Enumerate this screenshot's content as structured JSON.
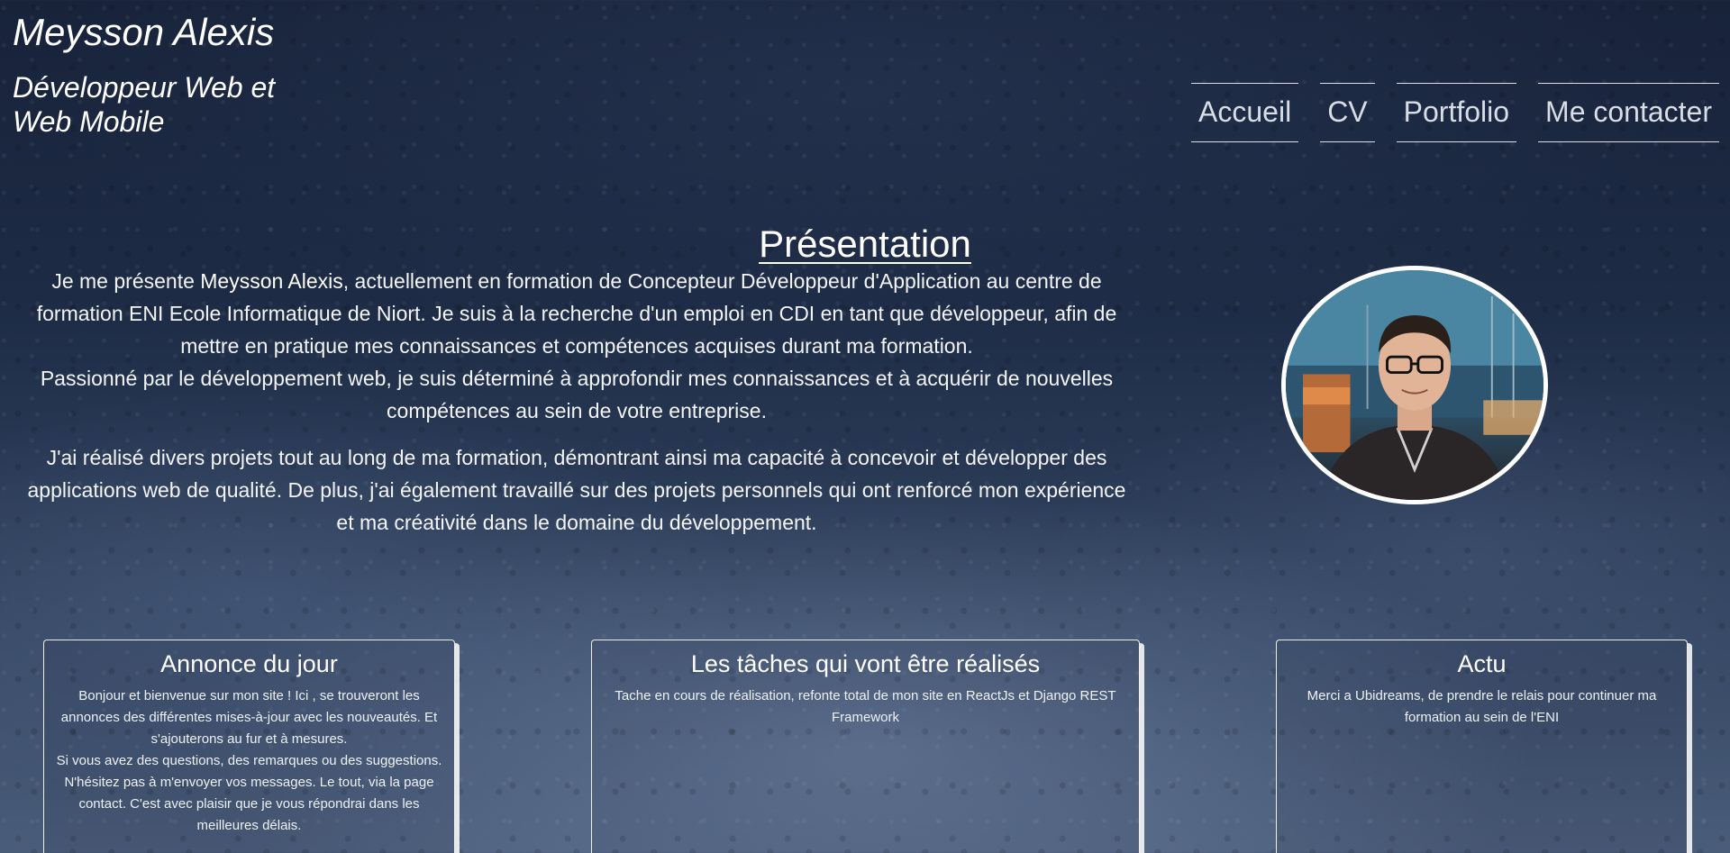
{
  "header": {
    "name": "Meysson Alexis",
    "subtitle": "Développeur Web et Web Mobile"
  },
  "nav": {
    "items": [
      {
        "label": "Accueil"
      },
      {
        "label": "CV"
      },
      {
        "label": "Portfolio"
      },
      {
        "label": "Me contacter"
      }
    ]
  },
  "presentation": {
    "title": "Présentation",
    "para1_before": "Je me présente ",
    "para1_name": "Meysson Alexis",
    "para1_after": ", actuellement en formation de Concepteur Développeur d'Application au centre de formation ENI Ecole Informatique de Niort. Je suis à la recherche d'un emploi en CDI en tant que développeur, afin de mettre en pratique mes connaissances et compétences acquises durant ma formation.",
    "para1_line2": "Passionné par le développement web, je suis déterminé à approfondir mes connaissances et à acquérir de nouvelles compétences au sein de votre entreprise.",
    "para2": "J'ai réalisé divers projets tout au long de ma formation, démontrant ainsi ma capacité à concevoir et développer des applications web de qualité. De plus, j'ai également travaillé sur des projets personnels qui ont renforcé mon expérience et ma créativité dans le domaine du développement."
  },
  "cards": [
    {
      "title": "Annonce du jour",
      "text": "Bonjour et bienvenue sur mon site ! Ici , se trouveront les annonces des différentes mises-à-jour avec les nouveautés. Et s'ajouterons au fur et à mesures.\nSi vous avez des questions, des remarques ou des suggestions. N'hésitez pas à m'envoyer vos messages. Le tout, via la page contact. C'est avec plaisir que je vous répondrai dans les meilleures délais."
    },
    {
      "title": "Les tâches qui vont être réalisés",
      "text": "Tache en cours de réalisation, refonte total de mon site en ReactJs et Django REST Framework"
    },
    {
      "title": "Actu",
      "text": "Merci a Ubidreams, de prendre le relais pour continuer ma formation au sein de l'ENI"
    }
  ],
  "colors": {
    "background": "#1d2b45",
    "text": "#ffffff",
    "nav_text": "#d8dde6"
  }
}
